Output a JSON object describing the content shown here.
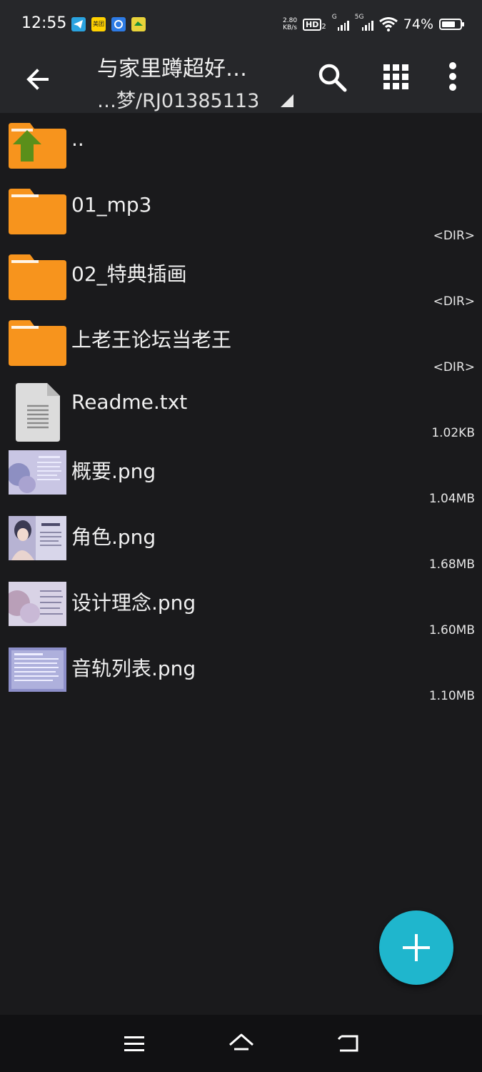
{
  "status_bar": {
    "time": "12:55",
    "net_speed_value": "2.80",
    "net_speed_unit": "KB/s",
    "hd_badge": "HD",
    "hd_sub": "2",
    "sig1_label": "G",
    "sig2_label": "5G",
    "battery_percent": "74%",
    "battery_level": 0.74,
    "notif_icons": [
      "telegram-icon",
      "meituan-icon",
      "app-blue-icon",
      "app-green-icon"
    ],
    "meituan_text": "美团"
  },
  "app_bar": {
    "title": "与家里蹲超好…",
    "path": "…梦/RJ01385113"
  },
  "files": [
    {
      "name": "..",
      "meta": "",
      "icon": "parent-folder-icon"
    },
    {
      "name": "01_mp3",
      "meta": "<DIR>",
      "icon": "folder-icon"
    },
    {
      "name": "02_特典插画",
      "meta": "<DIR>",
      "icon": "folder-icon"
    },
    {
      "name": "上老王论坛当老王",
      "meta": "<DIR>",
      "icon": "folder-icon"
    },
    {
      "name": "Readme.txt",
      "meta": "1.02KB",
      "icon": "text-file-icon"
    },
    {
      "name": "概要.png",
      "meta": "1.04MB",
      "icon": "image-thumbnail"
    },
    {
      "name": "角色.png",
      "meta": "1.68MB",
      "icon": "image-thumbnail"
    },
    {
      "name": "设计理念.png",
      "meta": "1.60MB",
      "icon": "image-thumbnail"
    },
    {
      "name": "音轨列表.png",
      "meta": "1.10MB",
      "icon": "image-thumbnail"
    }
  ],
  "colors": {
    "folder": "#f7941d",
    "folder_tab": "#ffa52e",
    "parent_arrow": "#5a8f1a",
    "fab": "#1fb6cd",
    "background": "#1a1a1c",
    "bar": "#26272a"
  }
}
